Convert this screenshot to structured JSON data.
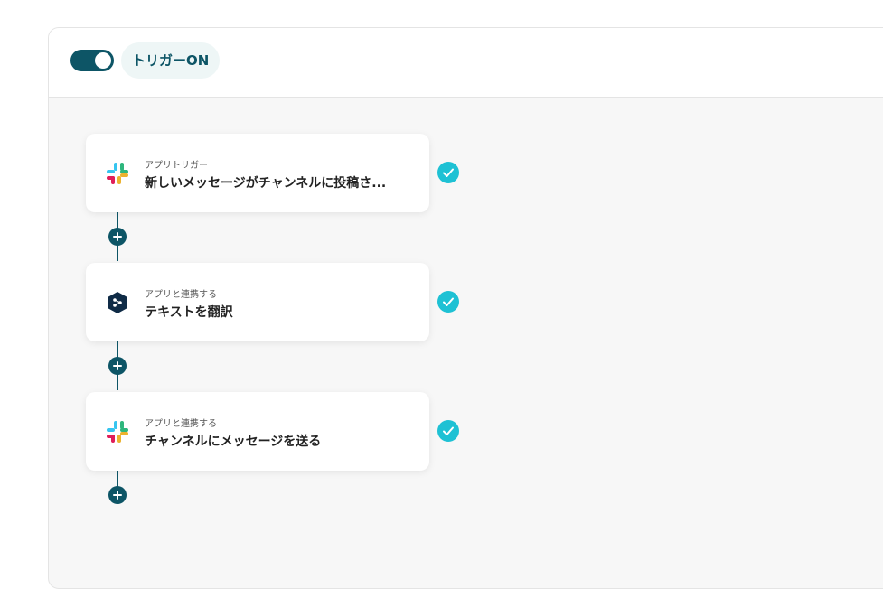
{
  "header": {
    "trigger_label": "トリガーON"
  },
  "steps": [
    {
      "subtitle": "アプリトリガー",
      "title": "新しいメッセージがチャンネルに投稿さ...",
      "app_icon": "slack-icon",
      "status": "completed"
    },
    {
      "subtitle": "アプリと連携する",
      "title": "テキストを翻訳",
      "app_icon": "deepl-icon",
      "status": "completed"
    },
    {
      "subtitle": "アプリと連携する",
      "title": "チャンネルにメッセージを送る",
      "app_icon": "slack-icon",
      "status": "completed"
    }
  ],
  "colors": {
    "primary": "#0d5566",
    "check": "#1ec1d4",
    "background": "#f7f7f7"
  }
}
